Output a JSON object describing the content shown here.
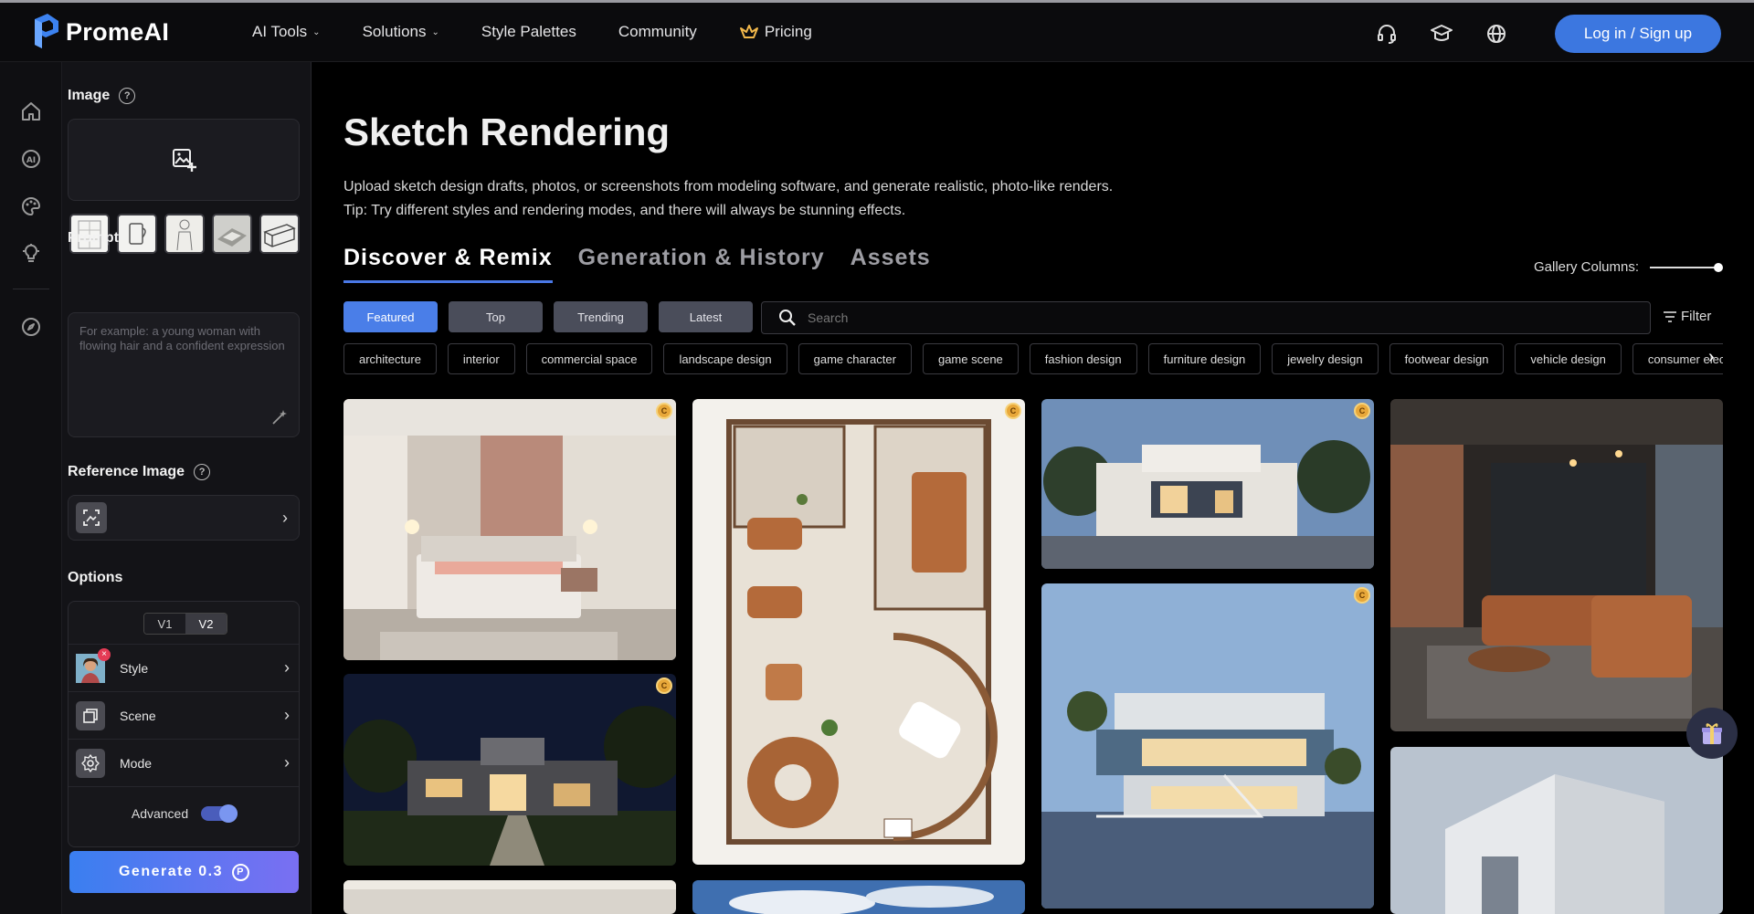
{
  "brand": {
    "name": "PromeAI"
  },
  "nav": {
    "items": [
      {
        "label": "AI Tools",
        "dropdown": true
      },
      {
        "label": "Solutions",
        "dropdown": true
      },
      {
        "label": "Style Palettes",
        "dropdown": false
      },
      {
        "label": "Community",
        "dropdown": false
      }
    ],
    "pricing_label": "Pricing",
    "login_label": "Log in / Sign up"
  },
  "panel": {
    "image_title": "Image",
    "prompt_title": "Prompt",
    "prompt_placeholder": "For example: a young woman with flowing hair and a confident expression",
    "reference_title": "Reference Image",
    "options_title": "Options",
    "versions": [
      "V1",
      "V2"
    ],
    "active_version": "V2",
    "options": [
      {
        "label": "Style",
        "icon": "portrait-icon"
      },
      {
        "label": "Scene",
        "icon": "layers-icon"
      },
      {
        "label": "Mode",
        "icon": "settings-icon"
      }
    ],
    "advanced_label": "Advanced",
    "advanced_on": true,
    "generate_label": "Generate 0.3"
  },
  "main": {
    "title": "Sketch Rendering",
    "desc_line1": "Upload sketch design drafts, photos, or screenshots from modeling software, and generate realistic, photo-like renders.",
    "desc_line2": "Tip: Try different styles and rendering modes, and there will always be stunning effects.",
    "tabs": [
      "Discover & Remix",
      "Generation & History",
      "Assets"
    ],
    "active_tab": "Discover & Remix",
    "gallery_columns_label": "Gallery Columns:",
    "sort_pills": [
      "Featured",
      "Top",
      "Trending",
      "Latest"
    ],
    "active_pill": "Featured",
    "search_placeholder": "Search",
    "filter_label": "Filter",
    "categories": [
      "architecture",
      "interior",
      "commercial space",
      "landscape design",
      "game character",
      "game scene",
      "fashion design",
      "furniture design",
      "jewelry design",
      "footwear design",
      "vehicle design",
      "consumer electronics"
    ]
  },
  "colors": {
    "accent": "#4a7ee8",
    "login": "#3c77e0",
    "badge": "#e8a83a"
  }
}
